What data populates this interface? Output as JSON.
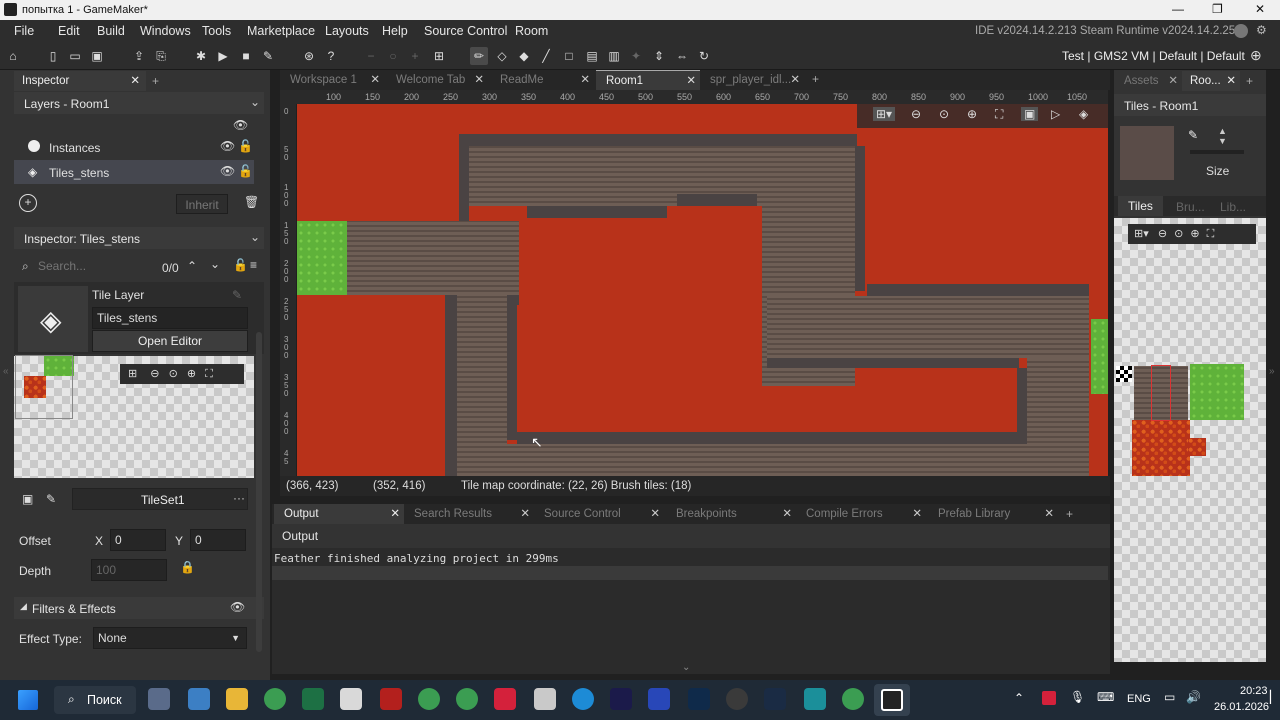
{
  "window": {
    "title": "попытка 1 - GameMaker*"
  },
  "menu": [
    "File",
    "Edit",
    "Build",
    "Windows",
    "Tools",
    "Marketplace",
    "Layouts",
    "Help",
    "Source Control",
    "Room"
  ],
  "ide_info": "IDE v2024.14.2.213 Steam  Runtime v2024.14.2.256",
  "target_bar": {
    "config": "Test",
    "platform": "GMS2 VM",
    "device": "Default",
    "output": "Default"
  },
  "left": {
    "tab": "Inspector",
    "layers_title": "Layers - Room1",
    "layers": [
      {
        "name": "Instances",
        "icon": "instances-icon"
      },
      {
        "name": "Tiles_stens",
        "icon": "tile-layer-icon"
      }
    ],
    "inherit_label": "Inherit",
    "inspector_title": "Inspector: Tiles_stens",
    "search_placeholder": "Search...",
    "search_count": "0/0",
    "layer_type": "Tile Layer",
    "layer_name": "Tiles_stens",
    "open_editor": "Open Editor",
    "tileset": "TileSet1",
    "offset_label": "Offset",
    "x_label": "X",
    "x_value": "0",
    "y_label": "Y",
    "y_value": "0",
    "depth_label": "Depth",
    "depth_value": "100",
    "filters_label": "Filters & Effects",
    "effect_label": "Effect Type:",
    "effect_value": "None"
  },
  "center": {
    "tabs": [
      "Workspace 1",
      "Welcome Tab",
      "ReadMe",
      "Room1",
      "spr_player_idl..."
    ],
    "ruler_x": [
      "100",
      "150",
      "200",
      "250",
      "300",
      "350",
      "400",
      "450",
      "500",
      "550",
      "600",
      "650",
      "700",
      "750",
      "800",
      "850",
      "900",
      "950",
      "1000",
      "1050"
    ],
    "ruler_y": [
      "0",
      "5\n0",
      "1\n0\n0",
      "1\n5\n0",
      "2\n0\n0",
      "2\n5\n0",
      "3\n0\n0",
      "3\n5\n0",
      "4\n0\n0",
      "4\n5"
    ],
    "status": {
      "mouse_room": "(366, 423)",
      "mouse_grid": "(352, 416)",
      "info": "Tile map coordinate: (22, 26) Brush tiles: (18)"
    },
    "output_tabs": [
      "Output",
      "Search Results",
      "Source Control",
      "Breakpoints",
      "Compile Errors",
      "Prefab Library"
    ],
    "output_header": "Output",
    "output_text": "Feather finished analyzing project in 299ms"
  },
  "right": {
    "tabs": [
      "Assets",
      "Roo..."
    ],
    "title": "Tiles - Room1",
    "size_label": "Size",
    "subtabs": [
      "Tiles",
      "Bru...",
      "Lib..."
    ]
  },
  "taskbar": {
    "search": "Поиск",
    "lang": "ENG",
    "time": "20:23",
    "date": "26.01.2026"
  }
}
